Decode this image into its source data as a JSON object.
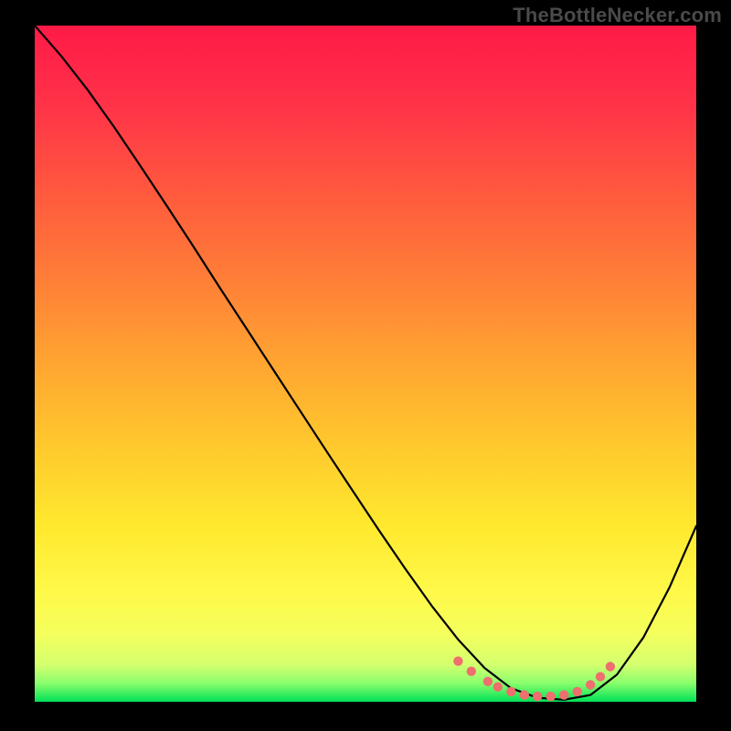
{
  "watermark": "TheBottleNecker.com",
  "chart_data": {
    "type": "line",
    "title": "",
    "xlabel": "",
    "ylabel": "",
    "xlim": [
      0,
      1
    ],
    "ylim": [
      0,
      1
    ],
    "series": [
      {
        "name": "curve",
        "x": [
          0.0,
          0.04,
          0.08,
          0.12,
          0.16,
          0.2,
          0.24,
          0.28,
          0.32,
          0.36,
          0.4,
          0.44,
          0.48,
          0.52,
          0.56,
          0.6,
          0.64,
          0.68,
          0.72,
          0.76,
          0.8,
          0.84,
          0.88,
          0.92,
          0.96,
          1.0
        ],
        "y": [
          1.0,
          0.955,
          0.905,
          0.85,
          0.792,
          0.733,
          0.673,
          0.612,
          0.552,
          0.492,
          0.432,
          0.372,
          0.313,
          0.254,
          0.197,
          0.142,
          0.092,
          0.05,
          0.02,
          0.006,
          0.003,
          0.01,
          0.04,
          0.095,
          0.17,
          0.26
        ]
      }
    ],
    "markers": {
      "name": "dashed-bottom",
      "x": [
        0.64,
        0.66,
        0.685,
        0.7,
        0.72,
        0.74,
        0.76,
        0.78,
        0.8,
        0.82,
        0.84,
        0.855,
        0.87
      ],
      "y": [
        0.06,
        0.045,
        0.03,
        0.022,
        0.015,
        0.01,
        0.008,
        0.008,
        0.01,
        0.015,
        0.025,
        0.037,
        0.052
      ]
    },
    "gradient_stops": [
      {
        "offset": 0.0,
        "color": "#ff1a47"
      },
      {
        "offset": 0.12,
        "color": "#ff3348"
      },
      {
        "offset": 0.25,
        "color": "#ff5a3e"
      },
      {
        "offset": 0.38,
        "color": "#ff8037"
      },
      {
        "offset": 0.5,
        "color": "#ffa531"
      },
      {
        "offset": 0.62,
        "color": "#ffc82d"
      },
      {
        "offset": 0.74,
        "color": "#ffe92e"
      },
      {
        "offset": 0.84,
        "color": "#fff94a"
      },
      {
        "offset": 0.9,
        "color": "#f4ff5d"
      },
      {
        "offset": 0.945,
        "color": "#d4ff6e"
      },
      {
        "offset": 0.972,
        "color": "#8cff6d"
      },
      {
        "offset": 1.0,
        "color": "#00e157"
      }
    ]
  }
}
